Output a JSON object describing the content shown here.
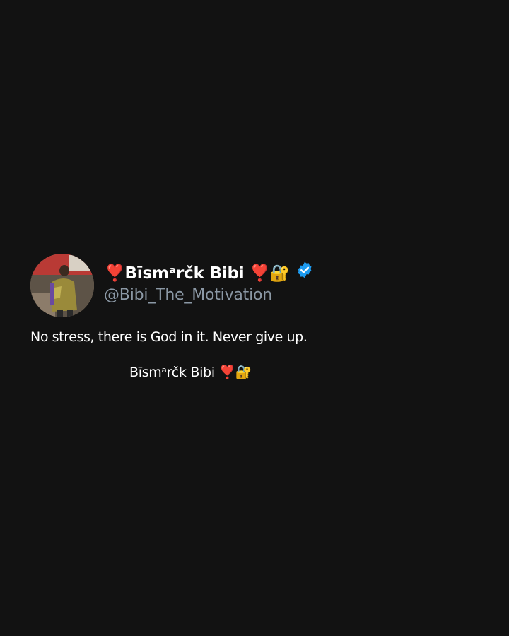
{
  "post": {
    "display_name": "❣️Bīsmᵃrčk Bibi ❣️🔐",
    "verified_icon": "verified-badge-icon",
    "handle": "@Bibi_The_Motivation",
    "text": "No stress, there is God in it. Never give up.",
    "signature": "Bīsmᵃrčk Bibi ❣️🔐"
  },
  "colors": {
    "background": "#121212",
    "primary_text": "#ffffff",
    "secondary_text": "#8b98a5",
    "verified_blue": "#1d9bf0"
  }
}
